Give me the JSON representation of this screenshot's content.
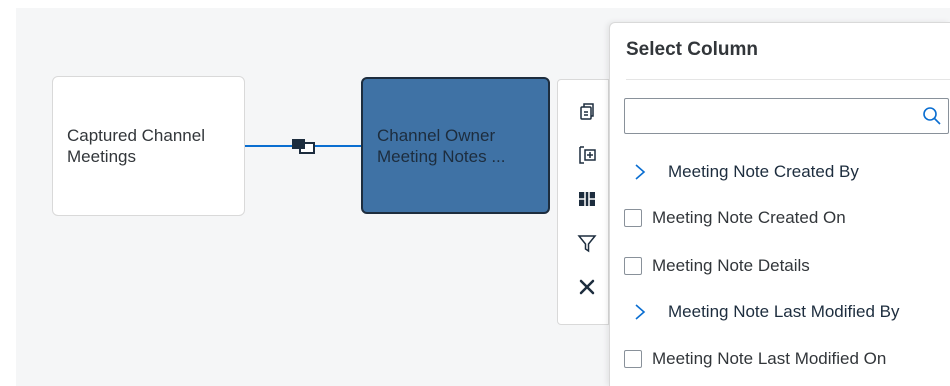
{
  "canvas": {
    "source_node": {
      "label": "Captured Channel\nMeetings"
    },
    "target_node": {
      "label": "Channel Owner\nMeeting Notes ..."
    },
    "join_icon": "join-icon"
  },
  "toolbar": {
    "tools": [
      {
        "name": "copy-icon"
      },
      {
        "name": "add-column-icon"
      },
      {
        "name": "columns-icon"
      },
      {
        "name": "filter-icon"
      },
      {
        "name": "close-icon"
      }
    ]
  },
  "select_column": {
    "title": "Select Column",
    "search": {
      "value": "",
      "placeholder": ""
    },
    "items": [
      {
        "label": "Meeting Note Created By",
        "type": "expandable"
      },
      {
        "label": "Meeting Note Created On",
        "type": "checkbox"
      },
      {
        "label": "Meeting Note Details",
        "type": "checkbox"
      },
      {
        "label": "Meeting Note Last Modified By",
        "type": "expandable"
      },
      {
        "label": "Meeting Note Last Modified On",
        "type": "checkbox"
      }
    ]
  },
  "colors": {
    "accent": "#0a6ed1",
    "selected_node": "#3f72a5",
    "canvas_bg": "#f5f6f7"
  }
}
